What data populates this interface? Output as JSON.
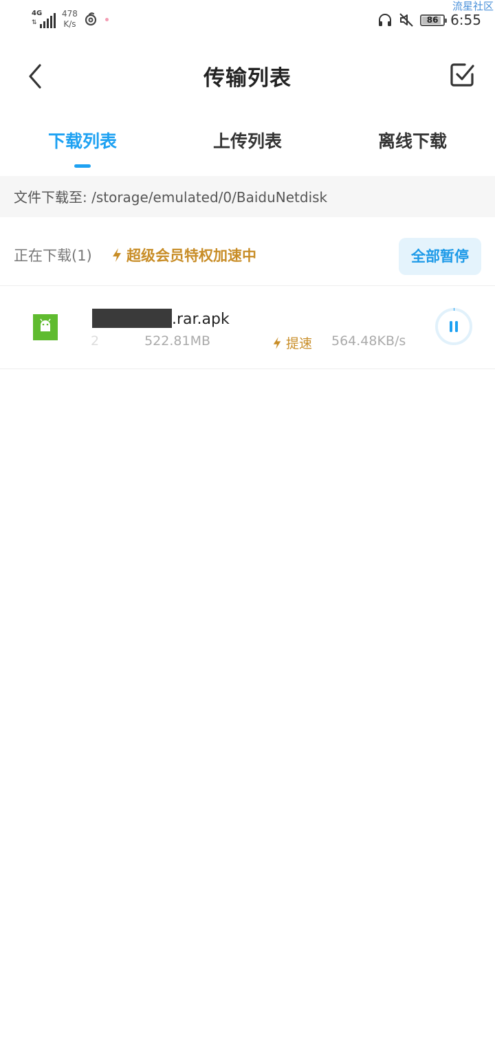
{
  "status_bar": {
    "network": "4G",
    "speed_value": "478",
    "speed_unit": "K/s",
    "battery": "86",
    "time": "6:55"
  },
  "watermark": "流星社区",
  "header": {
    "title": "传输列表"
  },
  "tabs": [
    {
      "label": "下载列表",
      "active": true
    },
    {
      "label": "上传列表",
      "active": false
    },
    {
      "label": "离线下载",
      "active": false
    }
  ],
  "path": {
    "text": "文件下载至: /storage/emulated/0/BaiduNetdisk"
  },
  "section": {
    "count_label": "正在下载(1)",
    "vip_label": "超级会员特权加速中",
    "pause_all_label": "全部暂停"
  },
  "download": {
    "name_suffix": ".rar.apk",
    "progress_left": "2",
    "size": "522.81MB",
    "speedup_label": "提速",
    "speed": "564.48KB/s"
  },
  "colors": {
    "accent": "#1da1f2",
    "vip_gold": "#c88d27",
    "apk_green": "#5fbb2f"
  },
  "icons": {
    "back": "chevron-left-icon",
    "select": "checkbox-icon",
    "lightning": "lightning-icon",
    "file": "android-apk-icon",
    "pause": "pause-icon"
  }
}
